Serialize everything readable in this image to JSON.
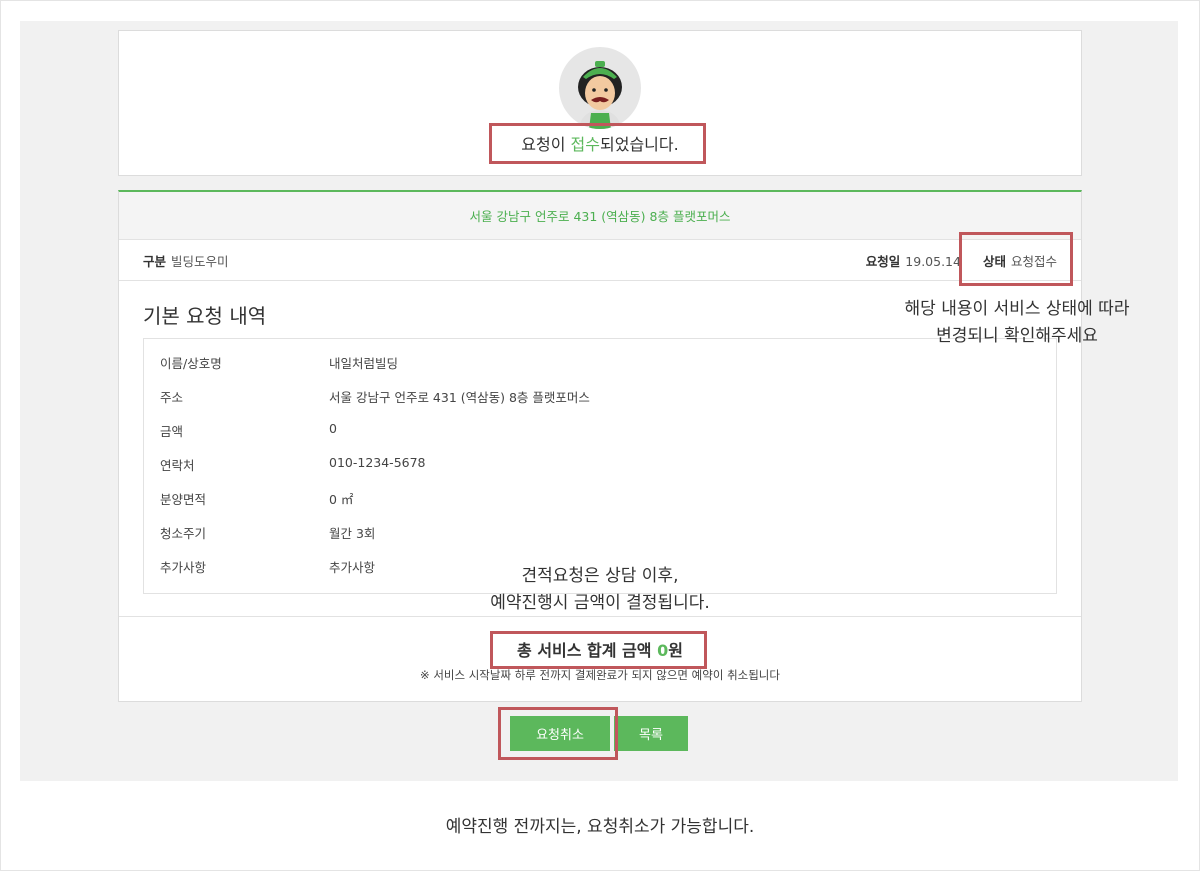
{
  "profile": {
    "status_prefix": "요청이 ",
    "status_accent": "접수",
    "status_suffix": "되었습니다."
  },
  "address": "서울 강남구 언주로 431 (역삼동) 8층 플랫포머스",
  "info_row": {
    "category_label": "구분",
    "category_value": "빌딩도우미",
    "date_label": "요청일",
    "date_value": "19.05.14",
    "state_label": "상태",
    "state_value": "요청접수"
  },
  "section_title": "기본 요청 내역",
  "details": [
    {
      "label": "이름/상호명",
      "value": "내일처럼빌딩"
    },
    {
      "label": "주소",
      "value": "서울 강남구 언주로 431 (역삼동) 8층 플랫포머스"
    },
    {
      "label": "금액",
      "value": "0"
    },
    {
      "label": "연락처",
      "value": "010-1234-5678"
    },
    {
      "label": "분양면적",
      "value": "0 ㎡"
    },
    {
      "label": "청소주기",
      "value": "월간 3회"
    },
    {
      "label": "추가사항",
      "value": "추가사항"
    }
  ],
  "total": {
    "prefix": "총 서비스 합계 금액 ",
    "amount": "0",
    "suffix": "원"
  },
  "notice": "※ 서비스 시작날짜 하루 전까지 결제완료가 되지 않으면 예약이 취소됩니다",
  "buttons": {
    "cancel": "요청취소",
    "list": "목록"
  },
  "callouts": {
    "status_note_line1": "해당 내용이 서비스 상태에 따라",
    "status_note_line2": "변경되니 확인해주세요",
    "quote_note_line1": "견적요청은 상담 이후,",
    "quote_note_line2": "예약진행시 금액이 결정됩니다."
  },
  "caption": "예약진행 전까지는, 요청취소가 가능합니다.",
  "colors": {
    "accent_green": "#5cb85c",
    "highlight_red": "#c0575b"
  }
}
